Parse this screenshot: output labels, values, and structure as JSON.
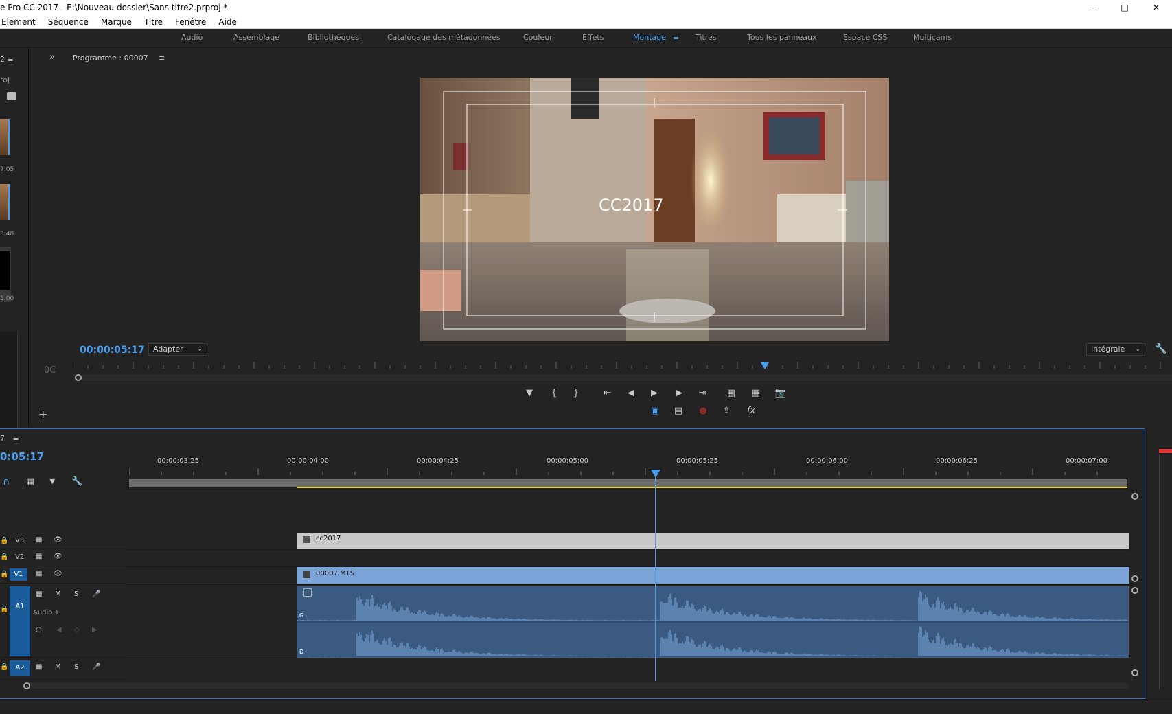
{
  "window": {
    "title": "e Pro CC 2017 - E:\\Nouveau dossier\\Sans titre2.prproj *"
  },
  "menu": [
    "Elément",
    "Séquence",
    "Marque",
    "Titre",
    "Fenêtre",
    "Aide"
  ],
  "workspaces": {
    "items": [
      "Audio",
      "Assemblage",
      "Bibliothèques",
      "Catalogage des métadonnées",
      "Couleur",
      "Effets",
      "Montage",
      "Titres",
      "Tous les panneaux",
      "Espace CSS",
      "Multicams"
    ],
    "active": "Montage"
  },
  "left_panel": {
    "label": "roj",
    "thumb_times": [
      "7:05",
      "3:48",
      "5:00"
    ],
    "side_text": "0C"
  },
  "program_monitor": {
    "title": "Programme : 00007",
    "video_overlay_text": "CC2017",
    "timecode": "00:00:05:17",
    "zoom": "Adapter",
    "quality": "Intégrale"
  },
  "timeline": {
    "sequence_label": "7",
    "timecode": "0:05:17",
    "ruler_ticks": [
      "00:00:03:25",
      "00:00:04:00",
      "00:00:04:25",
      "00:00:05:00",
      "00:00:05:25",
      "00:00:06:00",
      "00:00:06:25",
      "00:00:07:00"
    ],
    "tracks": [
      {
        "id": "V3",
        "clip": "cc2017"
      },
      {
        "id": "V2",
        "clip": ""
      },
      {
        "id": "V1",
        "clip": "00007.MTS"
      },
      {
        "id": "A1",
        "name": "Audio 1",
        "channels": [
          "G",
          "D"
        ]
      },
      {
        "id": "A2",
        "name": ""
      }
    ],
    "track_buttons": {
      "mute": "M",
      "solo": "S"
    }
  },
  "colors": {
    "accent": "#4a9ef0",
    "video_clip": "#7aa3d8",
    "title_clip": "#c9c9c9",
    "audio_clip": "#3a5a82",
    "waveform": "#7ea9df",
    "workarea": "#e8d33b"
  }
}
